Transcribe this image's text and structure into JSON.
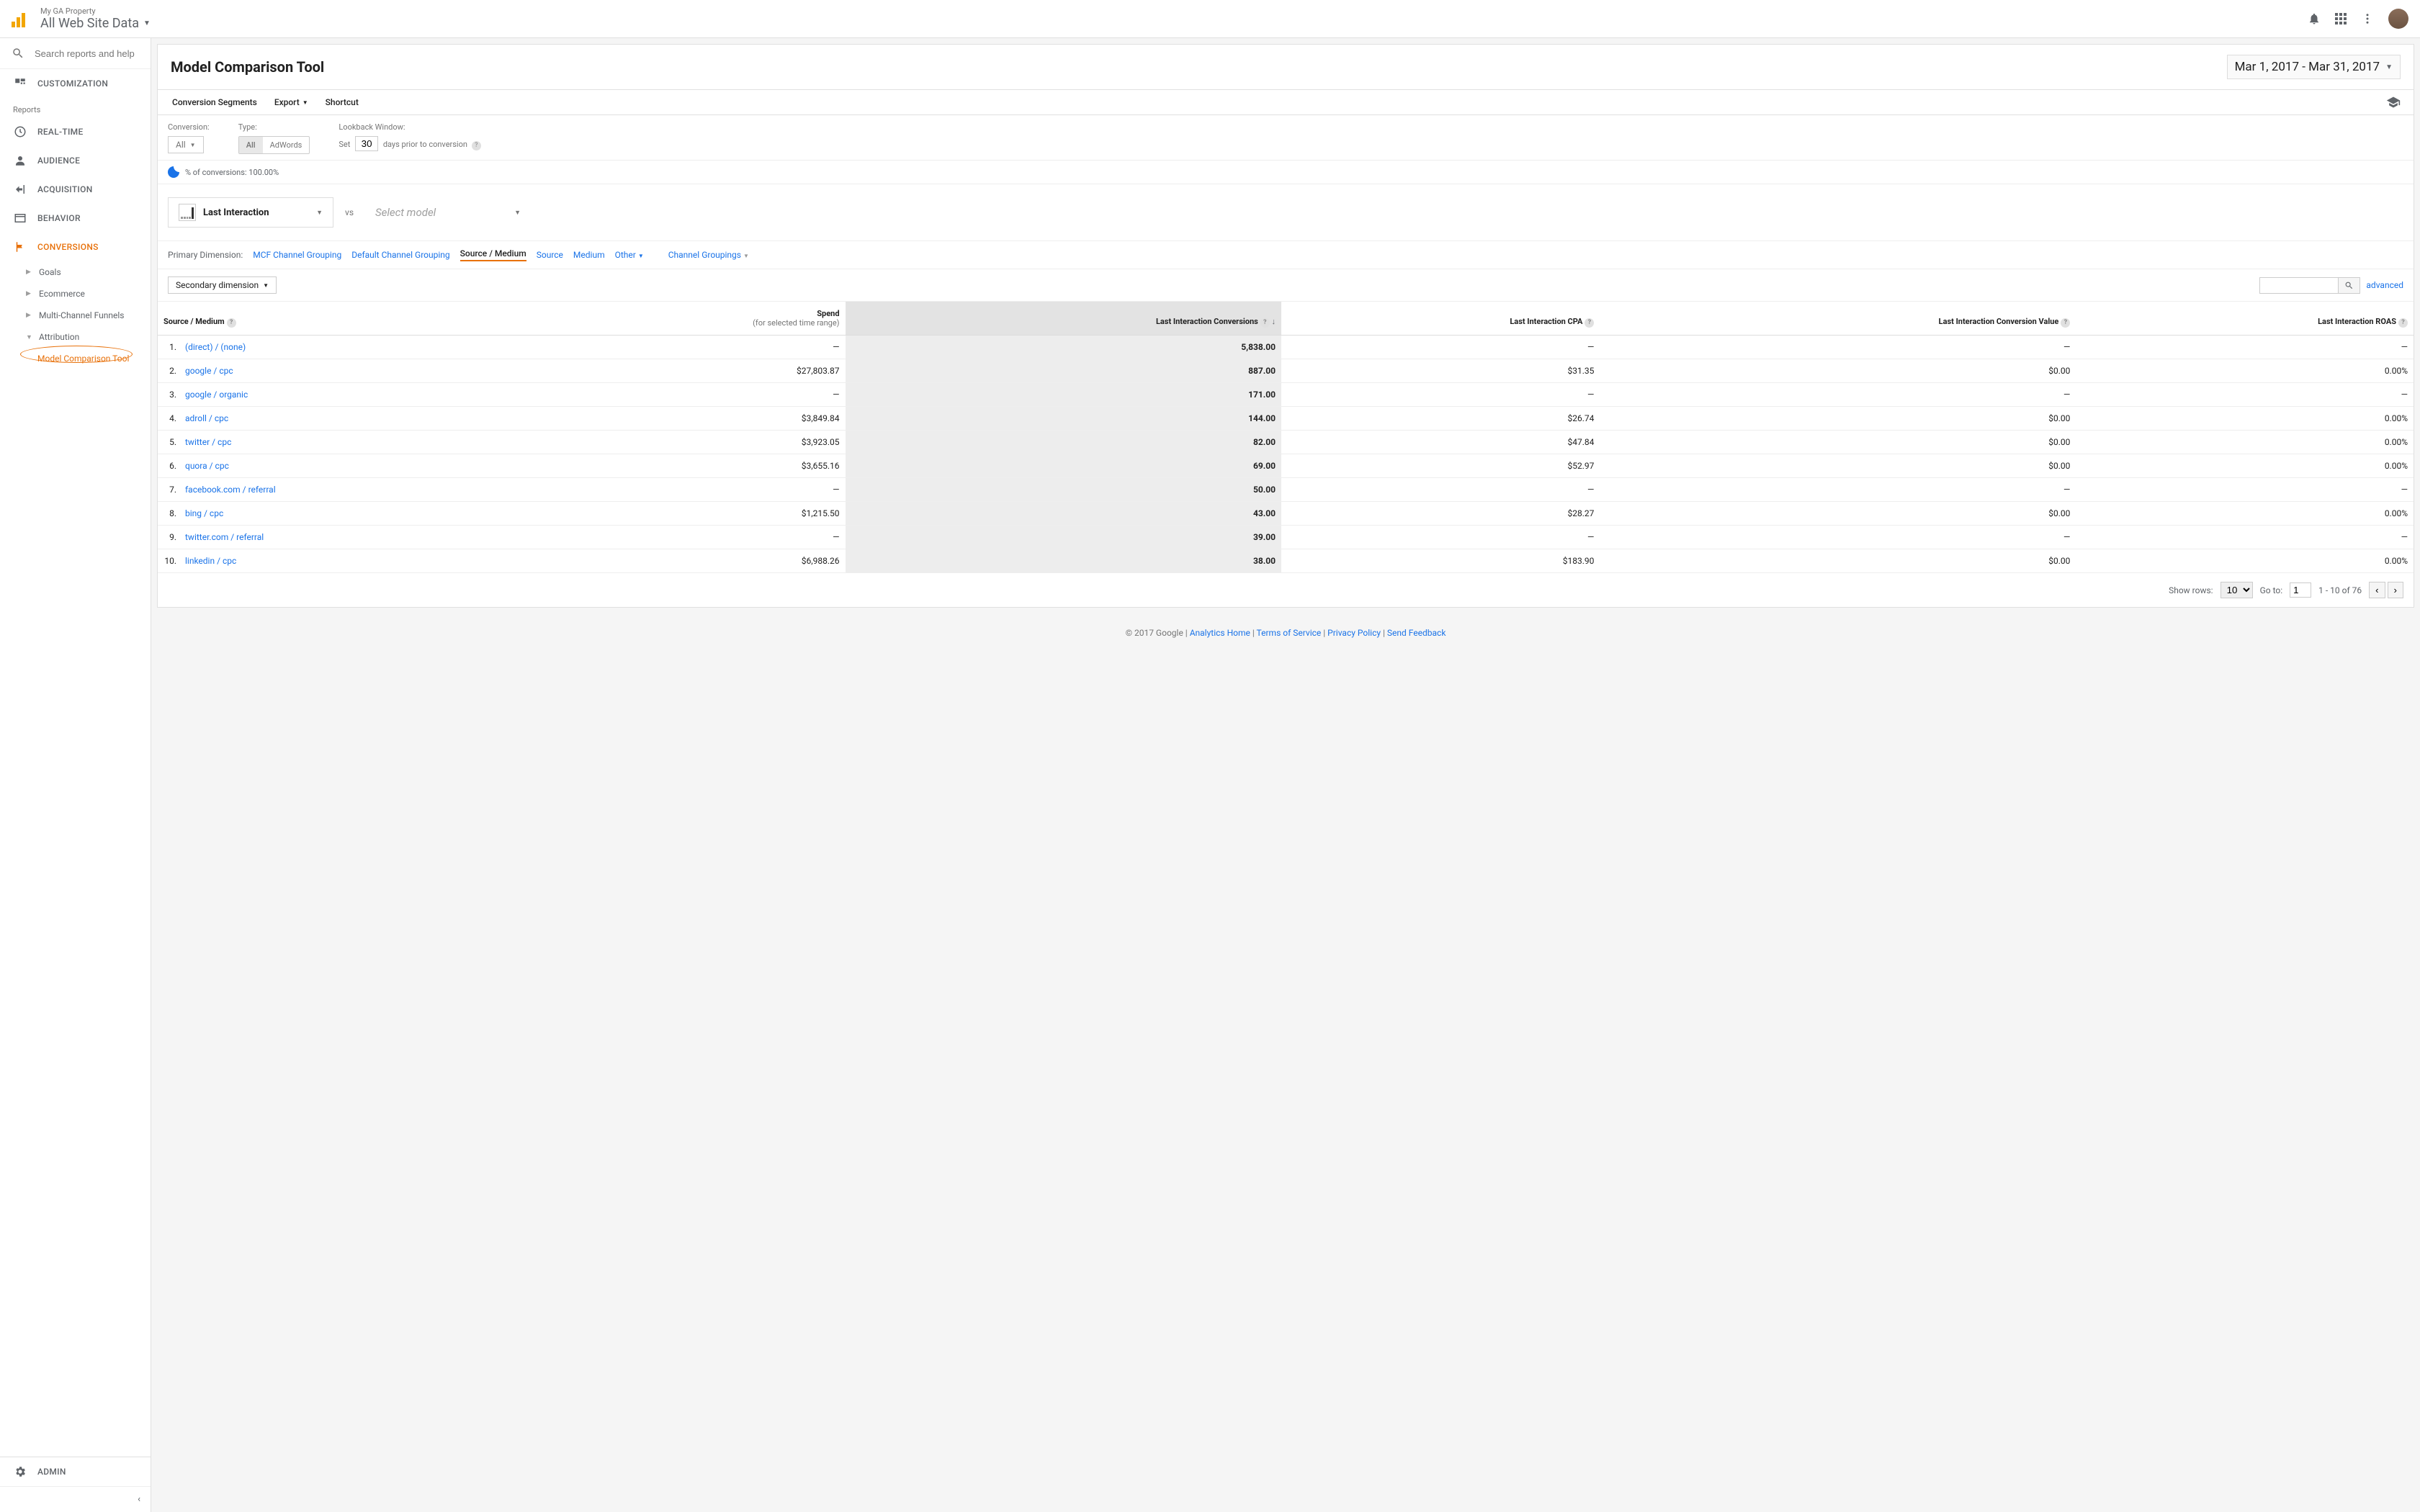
{
  "header": {
    "property": "My GA Property",
    "view": "All Web Site Data"
  },
  "sidebar": {
    "search_placeholder": "Search reports and help",
    "customization": "CUSTOMIZATION",
    "reports_label": "Reports",
    "realtime": "REAL-TIME",
    "audience": "AUDIENCE",
    "acquisition": "ACQUISITION",
    "behavior": "BEHAVIOR",
    "conversions": "CONVERSIONS",
    "goals": "Goals",
    "ecommerce": "Ecommerce",
    "mcf": "Multi-Channel Funnels",
    "attribution": "Attribution",
    "model_comparison": "Model Comparison Tool",
    "admin": "ADMIN"
  },
  "report": {
    "title": "Model Comparison Tool",
    "date_range": "Mar 1, 2017 - Mar 31, 2017",
    "toolbar": {
      "segments": "Conversion Segments",
      "export": "Export",
      "shortcut": "Shortcut"
    },
    "controls": {
      "conversion_label": "Conversion:",
      "conversion_value": "All",
      "type_label": "Type:",
      "type_all": "All",
      "type_adwords": "AdWords",
      "lookback_label": "Lookback Window:",
      "lookback_prefix": "Set",
      "lookback_value": "30",
      "lookback_suffix": "days prior to conversion",
      "pct_text": "% of conversions: 100.00%"
    },
    "model_selected": "Last Interaction",
    "vs": "vs",
    "model_placeholder": "Select model",
    "dimensions": {
      "label": "Primary Dimension:",
      "mcf": "MCF Channel Grouping",
      "default": "Default Channel Grouping",
      "source_medium": "Source / Medium",
      "source": "Source",
      "medium": "Medium",
      "other": "Other",
      "channel_groupings": "Channel Groupings"
    },
    "secondary_dimension": "Secondary dimension",
    "advanced": "advanced",
    "columns": {
      "source_medium": "Source / Medium",
      "spend": "Spend",
      "spend_sub": "(for selected time range)",
      "conversions": "Last Interaction Conversions",
      "cpa": "Last Interaction CPA",
      "value": "Last Interaction Conversion Value",
      "roas": "Last Interaction ROAS"
    },
    "rows": [
      {
        "idx": "1.",
        "dim": "(direct) / (none)",
        "spend": "—",
        "conv": "5,838.00",
        "cpa": "—",
        "value": "—",
        "roas": "—"
      },
      {
        "idx": "2.",
        "dim": "google / cpc",
        "spend": "$27,803.87",
        "conv": "887.00",
        "cpa": "$31.35",
        "value": "$0.00",
        "roas": "0.00%"
      },
      {
        "idx": "3.",
        "dim": "google / organic",
        "spend": "—",
        "conv": "171.00",
        "cpa": "—",
        "value": "—",
        "roas": "—"
      },
      {
        "idx": "4.",
        "dim": "adroll / cpc",
        "spend": "$3,849.84",
        "conv": "144.00",
        "cpa": "$26.74",
        "value": "$0.00",
        "roas": "0.00%"
      },
      {
        "idx": "5.",
        "dim": "twitter / cpc",
        "spend": "$3,923.05",
        "conv": "82.00",
        "cpa": "$47.84",
        "value": "$0.00",
        "roas": "0.00%"
      },
      {
        "idx": "6.",
        "dim": "quora / cpc",
        "spend": "$3,655.16",
        "conv": "69.00",
        "cpa": "$52.97",
        "value": "$0.00",
        "roas": "0.00%"
      },
      {
        "idx": "7.",
        "dim": "facebook.com / referral",
        "spend": "—",
        "conv": "50.00",
        "cpa": "—",
        "value": "—",
        "roas": "—"
      },
      {
        "idx": "8.",
        "dim": "bing / cpc",
        "spend": "$1,215.50",
        "conv": "43.00",
        "cpa": "$28.27",
        "value": "$0.00",
        "roas": "0.00%"
      },
      {
        "idx": "9.",
        "dim": "twitter.com / referral",
        "spend": "—",
        "conv": "39.00",
        "cpa": "—",
        "value": "—",
        "roas": "—"
      },
      {
        "idx": "10.",
        "dim": "linkedin / cpc",
        "spend": "$6,988.26",
        "conv": "38.00",
        "cpa": "$183.90",
        "value": "$0.00",
        "roas": "0.00%"
      }
    ],
    "pager": {
      "show_rows": "Show rows:",
      "rows_value": "10",
      "goto": "Go to:",
      "goto_value": "1",
      "range": "1 - 10 of 76"
    }
  },
  "footer": {
    "copyright": "© 2017 Google",
    "analytics_home": "Analytics Home",
    "terms": "Terms of Service",
    "privacy": "Privacy Policy",
    "feedback": "Send Feedback"
  }
}
